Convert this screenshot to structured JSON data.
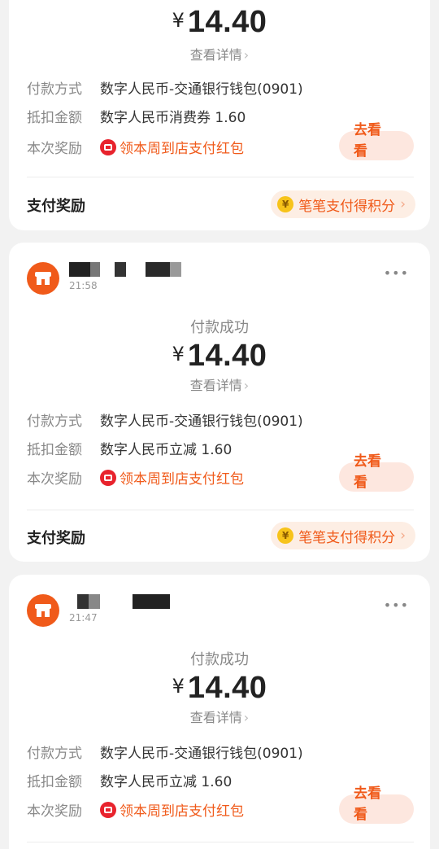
{
  "colors": {
    "accent": "#f05a1a",
    "red_icon": "#e8232d",
    "coin": "#f7c31a"
  },
  "cards": [
    {
      "time": "",
      "status": "",
      "currency": "¥",
      "amount": "14.40",
      "detail_link": "查看详情",
      "payment_method_label": "付款方式",
      "payment_method": "数字人民币-交通银行钱包(0901)",
      "deduction_label": "抵扣金额",
      "deduction": "数字人民币消费券 1.60",
      "reward_label": "本次奖励",
      "reward": "领本周到店支付红包",
      "go_button": "去看看",
      "pay_reward_title": "支付奖励",
      "points_pill": "笔笔支付得积分"
    },
    {
      "time": "21:58",
      "status": "付款成功",
      "currency": "¥",
      "amount": "14.40",
      "detail_link": "查看详情",
      "payment_method_label": "付款方式",
      "payment_method": "数字人民币-交通银行钱包(0901)",
      "deduction_label": "抵扣金额",
      "deduction": "数字人民币立减 1.60",
      "reward_label": "本次奖励",
      "reward": "领本周到店支付红包",
      "go_button": "去看看",
      "pay_reward_title": "支付奖励",
      "points_pill": "笔笔支付得积分"
    },
    {
      "time": "21:47",
      "status": "付款成功",
      "currency": "¥",
      "amount": "14.40",
      "detail_link": "查看详情",
      "payment_method_label": "付款方式",
      "payment_method": "数字人民币-交通银行钱包(0901)",
      "deduction_label": "抵扣金额",
      "deduction": "数字人民币立减 1.60",
      "reward_label": "本次奖励",
      "reward": "领本周到店支付红包",
      "go_button": "去看看"
    }
  ],
  "icons": {
    "store": "store-icon",
    "more": "more-icon",
    "gift": "gift-icon",
    "coin": "coin-icon",
    "chevron": "chevron-right-icon"
  }
}
